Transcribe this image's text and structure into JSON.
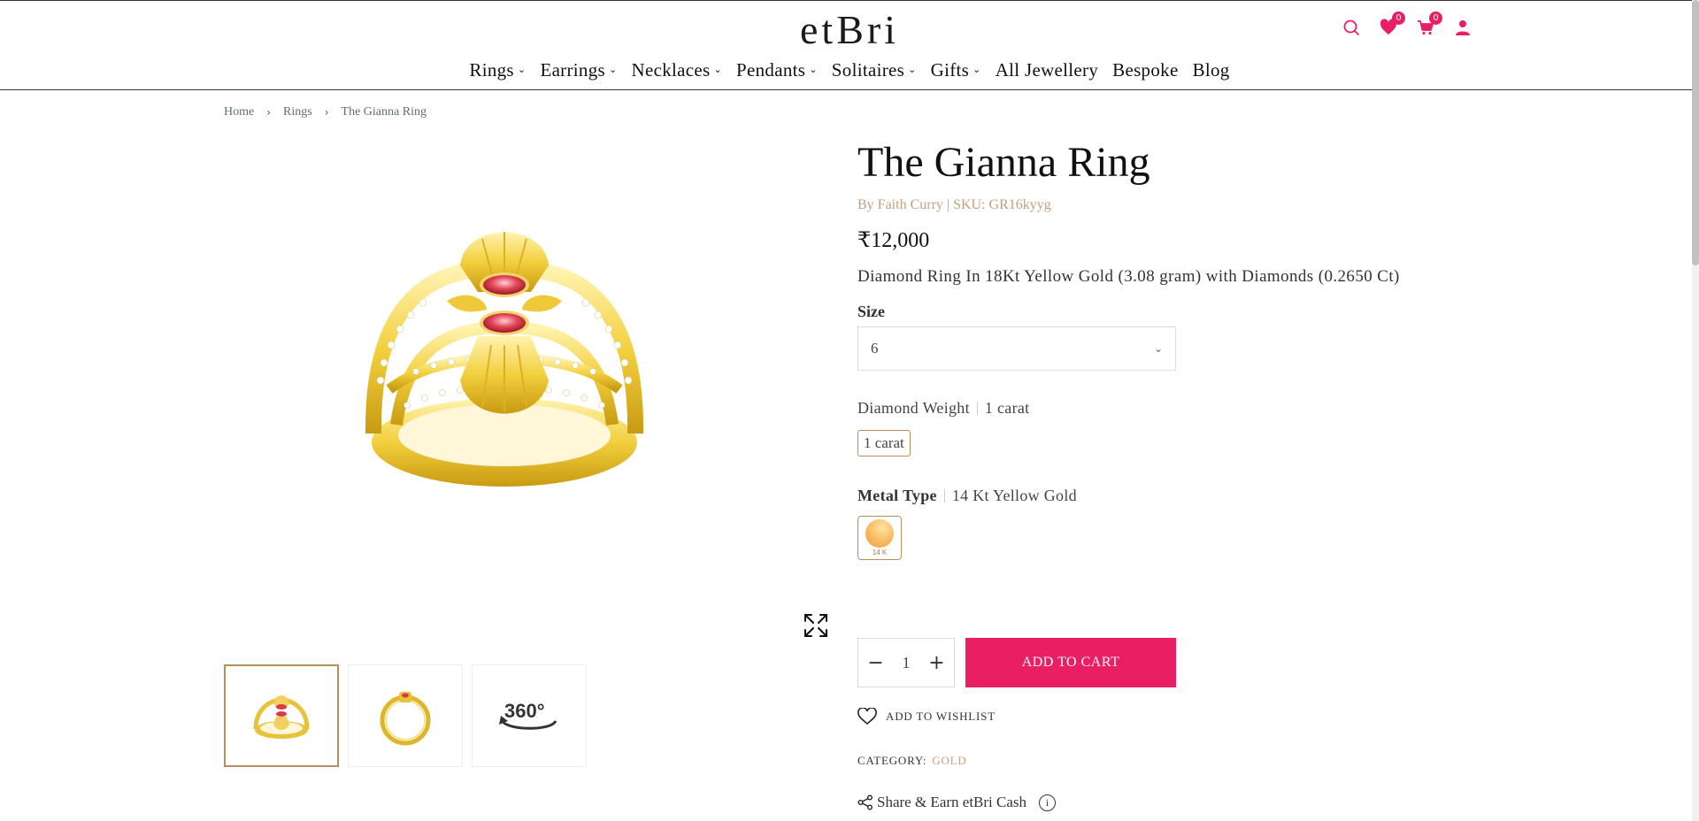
{
  "header": {
    "logo": "etBri",
    "wishlist_count": "0",
    "cart_count": "0",
    "nav": [
      {
        "label": "Rings",
        "dropdown": true
      },
      {
        "label": "Earrings",
        "dropdown": true
      },
      {
        "label": "Necklaces",
        "dropdown": true
      },
      {
        "label": "Pendants",
        "dropdown": true
      },
      {
        "label": "Solitaires",
        "dropdown": true
      },
      {
        "label": "Gifts",
        "dropdown": true
      },
      {
        "label": "All Jewellery",
        "dropdown": false
      },
      {
        "label": "Bespoke",
        "dropdown": false
      },
      {
        "label": "Blog",
        "dropdown": false
      }
    ],
    "icons": [
      "search-icon",
      "heart-icon",
      "cart-icon",
      "user-icon"
    ],
    "accent_color": "#e91e63"
  },
  "breadcrumb": [
    "Home",
    "Rings",
    "The Gianna Ring"
  ],
  "gallery": {
    "thumb_3_label": "360°"
  },
  "product": {
    "title": "The Gianna Ring",
    "byline": "By Faith Curry  | SKU: GR16kyyg",
    "price": "₹12,000",
    "description": "Diamond Ring In 18Kt Yellow Gold (3.08 gram) with Diamonds (0.2650 Ct)",
    "size_label": "Size",
    "size_value": "6",
    "diamond_weight_label": "Diamond Weight",
    "diamond_weight_value": "1 carat",
    "diamond_weight_chip": "1 carat",
    "metal_type_label": "Metal Type",
    "metal_type_value": "14 Kt Yellow Gold",
    "metal_swatch_tag": "14 K",
    "quantity": "1",
    "add_to_cart": "ADD TO CART",
    "add_to_wishlist": "ADD TO WISHLIST",
    "category_label": "CATEGORY:",
    "category_value": "GOLD",
    "share_text": "Share & Earn etBri Cash"
  }
}
